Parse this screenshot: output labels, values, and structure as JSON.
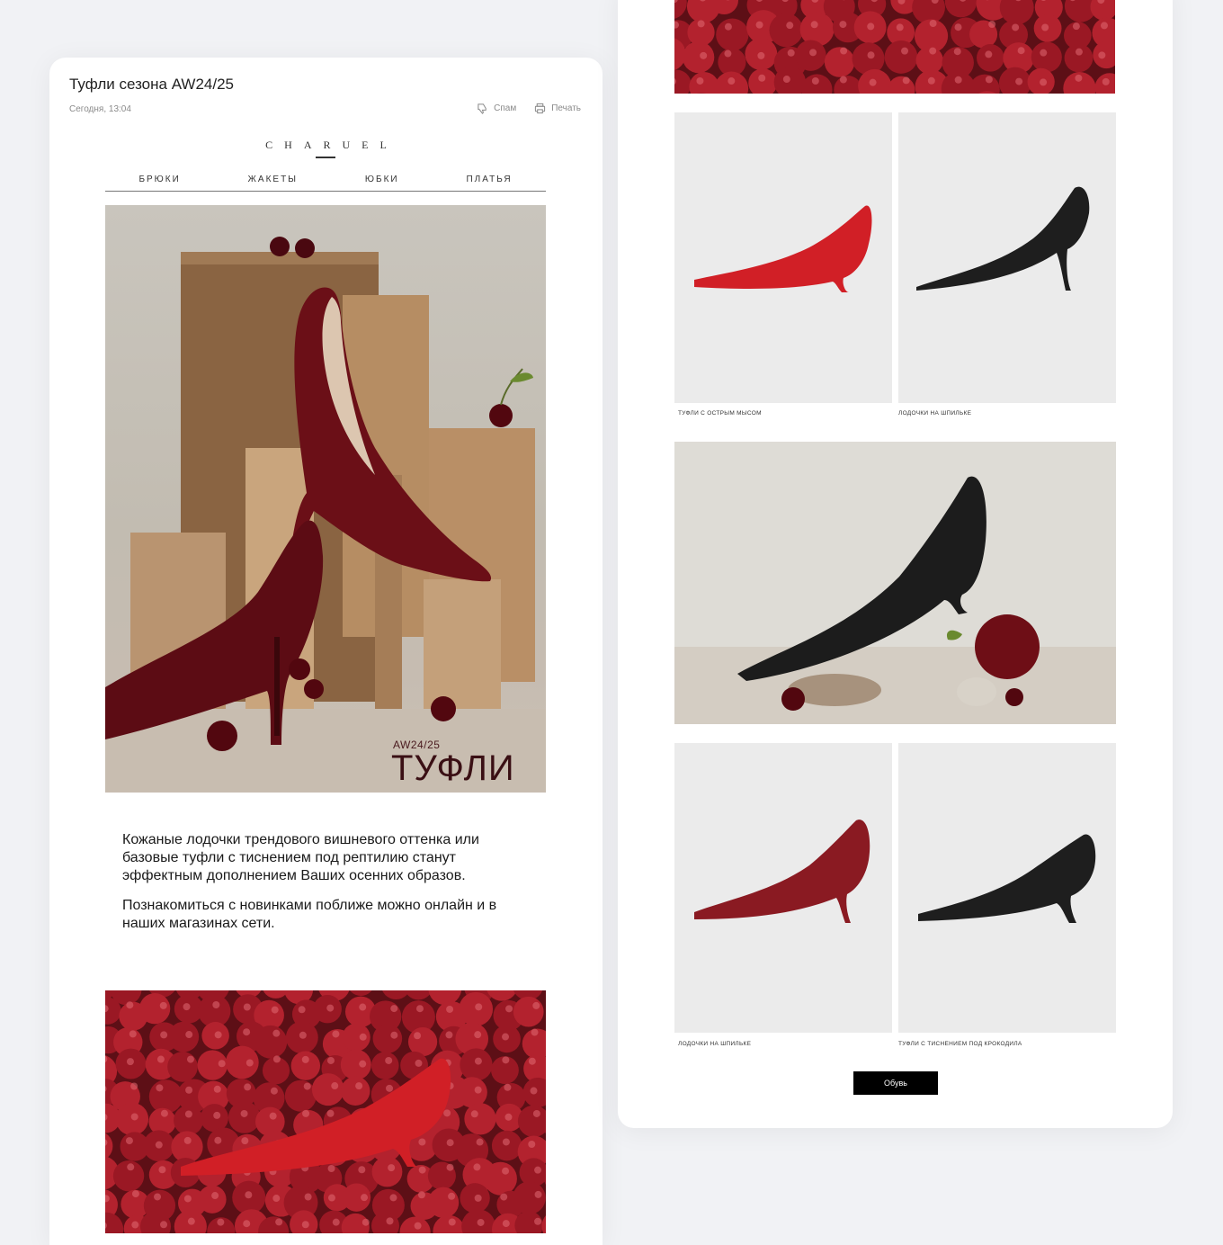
{
  "mail": {
    "subject": "Туфли сезона AW24/25",
    "date": "Сегодня, 13:04",
    "actions": {
      "spam": "Спам",
      "print": "Печать"
    }
  },
  "brand": {
    "logo": "CHARUEL"
  },
  "nav": [
    "БРЮКИ",
    "ЖАКЕТЫ",
    "ЮБКИ",
    "ПЛАТЬЯ"
  ],
  "hero": {
    "tag": "AW24/25",
    "title": "ТУФЛИ"
  },
  "body": {
    "paragraph1": "Кожаные лодочки трендового вишневого оттенка или базовые туфли с тиснением под рептилию станут эффектным дополнением Ваших осенних образов.",
    "paragraph2": "Познакомиться с новинками поближе можно онлайн и в наших магазинах сети."
  },
  "products": [
    {
      "label": "ТУФЛИ С ОСТРЫМ МЫСОМ",
      "color": "#d11f26"
    },
    {
      "label": "ЛОДОЧКИ НА ШПИЛЬКЕ",
      "color": "#1e1e1e"
    },
    {
      "label": "ЛОДОЧКИ НА ШПИЛЬКЕ",
      "color": "#8a1a22"
    },
    {
      "label": "ТУФЛИ С ТИСНЕНИЕМ ПОД КРОКОДИЛА",
      "color": "#1e1e1e"
    }
  ],
  "cta": {
    "label": "Обувь"
  },
  "colors": {
    "cherry": "#6b0f17",
    "plum": "#b3222e",
    "background": "#f1f2f5"
  }
}
